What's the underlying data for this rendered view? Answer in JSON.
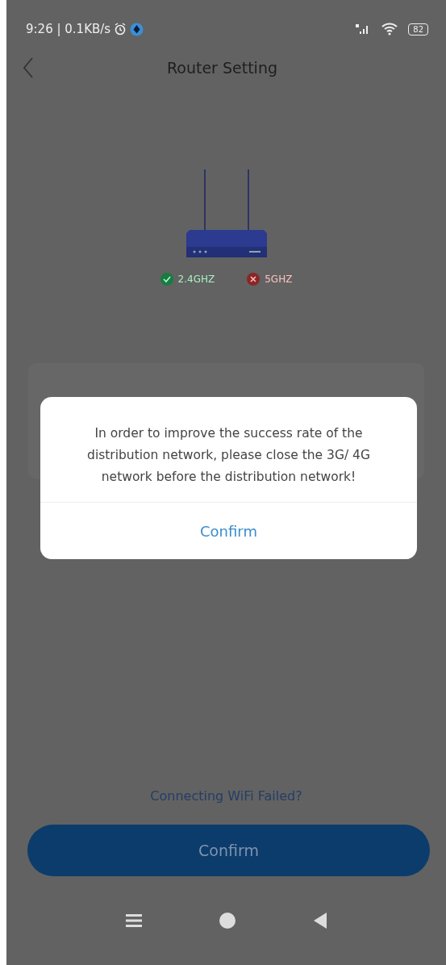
{
  "status_bar": {
    "time": "9:26 | 0.1KB/s",
    "battery": "82"
  },
  "header": {
    "title": "Router Setting"
  },
  "bands": [
    {
      "label": "2.4GHZ",
      "supported": true
    },
    {
      "label": "5GHZ",
      "supported": false
    }
  ],
  "dialog": {
    "message": "In order to improve the success rate of the distribution network, please close the 3G/ 4G network before the distribution network!",
    "button": "Confirm"
  },
  "help_link": "Connecting WiFi Failed?",
  "primary_button": "Confirm"
}
